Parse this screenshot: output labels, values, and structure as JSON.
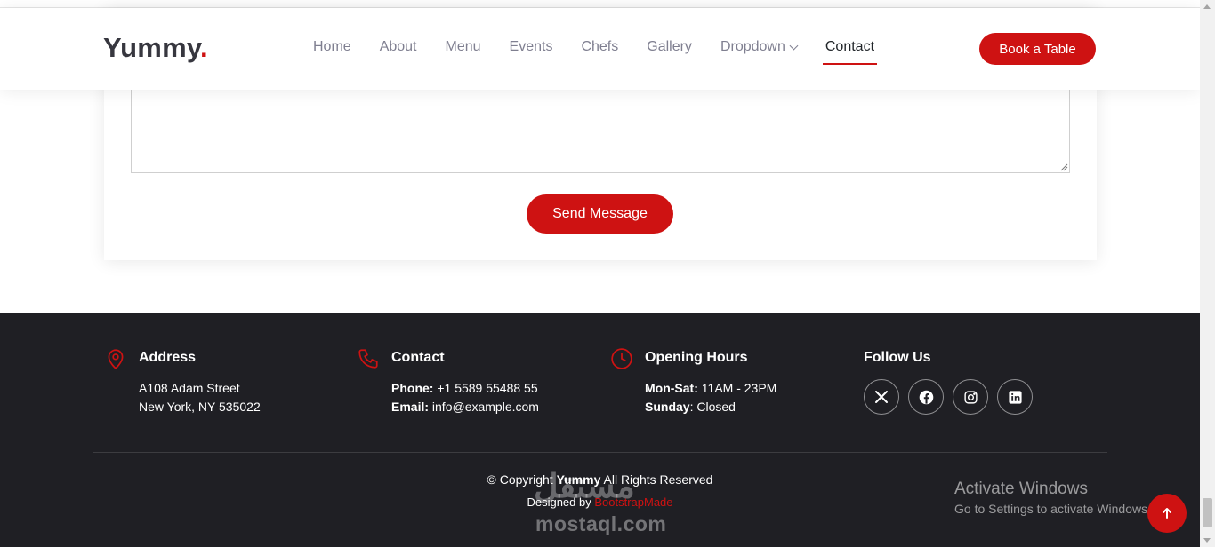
{
  "header": {
    "logo_text": "Yummy",
    "logo_dot": ".",
    "nav": [
      {
        "label": "Home"
      },
      {
        "label": "About"
      },
      {
        "label": "Menu"
      },
      {
        "label": "Events"
      },
      {
        "label": "Chefs"
      },
      {
        "label": "Gallery"
      },
      {
        "label": "Dropdown"
      },
      {
        "label": "Contact"
      }
    ],
    "active_nav": "Contact",
    "book_label": "Book a Table"
  },
  "form": {
    "message_value": "",
    "send_label": "Send Message"
  },
  "footer": {
    "address": {
      "title": "Address",
      "line1": "A108 Adam Street",
      "line2": "New York, NY 535022"
    },
    "contact": {
      "title": "Contact",
      "phone_label": "Phone:",
      "phone_value": " +1 5589 55488 55",
      "email_label": "Email:",
      "email_value": " info@example.com"
    },
    "hours": {
      "title": "Opening Hours",
      "weekday_label": "Mon-Sat:",
      "weekday_value": " 11AM - 23PM",
      "sunday_label": "Sunday",
      "sunday_value": ": Closed"
    },
    "follow": {
      "title": "Follow Us",
      "icons": [
        "x-twitter-icon",
        "facebook-icon",
        "instagram-icon",
        "linkedin-icon"
      ]
    },
    "copyright_prefix": "© Copyright",
    "copyright_brand": "Yummy",
    "copyright_suffix": "All Rights Reserved",
    "designed_prefix": "Designed by",
    "designed_link": "BootstrapMade"
  },
  "overlay": {
    "watermark_ar": "مستقل",
    "watermark_en": "mostaql.com",
    "activate_title": "Activate Windows",
    "activate_sub": "Go to Settings to activate Windows."
  },
  "colors": {
    "accent": "#ce1212",
    "footer_bg": "#1f1f24",
    "logo": "#37373f"
  }
}
